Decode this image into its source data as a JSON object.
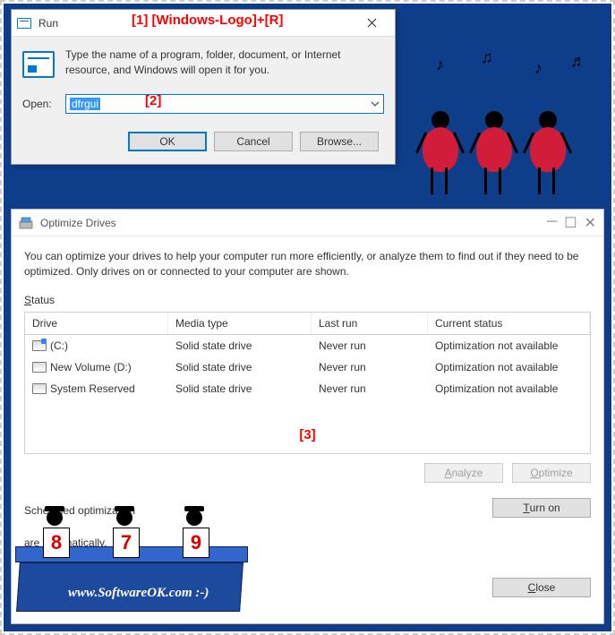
{
  "annotations": {
    "a1": "[1]  [Windows-Logo]+[R]",
    "a2": "[2]",
    "a3": "[3]"
  },
  "run": {
    "title": "Run",
    "description": "Type the name of a program, folder, document, or Internet resource, and Windows will open it for you.",
    "open_label": "Open:",
    "open_value": "dfrgui",
    "ok": "OK",
    "cancel": "Cancel",
    "browse": "Browse..."
  },
  "optimize": {
    "title": "Optimize Drives",
    "intro": "You can optimize your drives to help your computer run more efficiently, or analyze them to find out if they need to be optimized. Only drives on or connected to your computer are shown.",
    "status_label": "Status",
    "columns": {
      "drive": "Drive",
      "media": "Media type",
      "last": "Last run",
      "status": "Current status"
    },
    "rows": [
      {
        "name": "(C:)",
        "media": "Solid state drive",
        "last": "Never run",
        "status": "Optimization not available"
      },
      {
        "name": "New Volume (D:)",
        "media": "Solid state drive",
        "last": "Never run",
        "status": "Optimization not available"
      },
      {
        "name": "System Reserved",
        "media": "Solid state drive",
        "last": "Never run",
        "status": "Optimization not available"
      }
    ],
    "analyze": "Analyze",
    "optimize_btn": "Optimize",
    "sched_heading": "Scheduled optimization",
    "sched_text": "are                   opti          matically.",
    "turn_on": "Turn on",
    "close": "Close"
  },
  "scores": {
    "s1": "8",
    "s2": "7",
    "s3": "9"
  },
  "website": "www.SoftwareOK.com :-)"
}
